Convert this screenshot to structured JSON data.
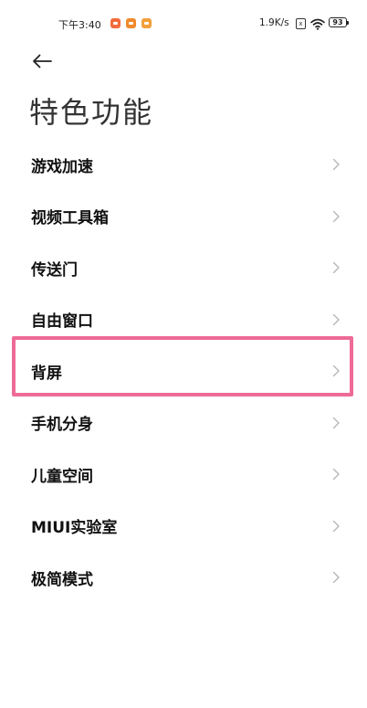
{
  "status_bar": {
    "time": "下午3:40",
    "net_speed": "1.9K/s",
    "sim_glyph": "x",
    "battery_level": "93",
    "notification_icons": [
      "app-notification-icon",
      "app-notification-icon",
      "app-notification-icon"
    ]
  },
  "header": {
    "back_icon": "arrow-left-icon",
    "title": "特色功能"
  },
  "menu": {
    "chevron_icon": "chevron-right-icon",
    "items": [
      {
        "label": "游戏加速"
      },
      {
        "label": "视频工具箱"
      },
      {
        "label": "传送门"
      },
      {
        "label": "自由窗口"
      },
      {
        "label": "背屏"
      },
      {
        "label": "手机分身"
      },
      {
        "label": "儿童空间"
      },
      {
        "label": "MIUI实验室"
      },
      {
        "label": "极简模式"
      }
    ],
    "highlighted_item": "背屏"
  },
  "colors": {
    "highlight": "#ee6a97",
    "chevron": "#b5b5b5",
    "text": "#111111",
    "title": "#333333"
  }
}
